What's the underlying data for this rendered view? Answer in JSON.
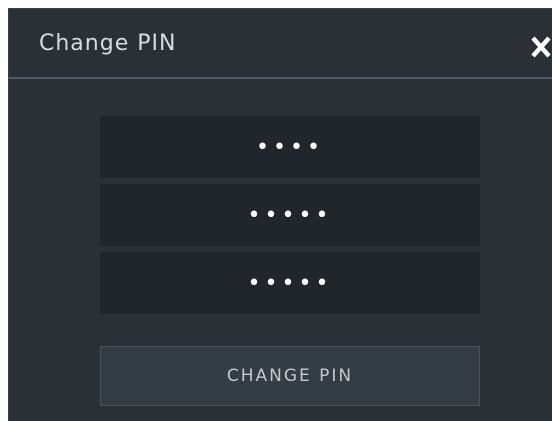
{
  "dialog": {
    "title": "Change PIN",
    "close_icon": "close-icon"
  },
  "fields": [
    {
      "name": "current-pin",
      "value": "••••"
    },
    {
      "name": "new-pin",
      "value": "•••••"
    },
    {
      "name": "confirm-pin",
      "value": "•••••"
    }
  ],
  "submit": {
    "label": "CHANGE PIN"
  },
  "colors": {
    "dialog_bg": "#2a3036",
    "field_bg": "#20262b",
    "button_bg": "#353d44",
    "divider": "#4e5a63",
    "title_text": "#d6dbdf",
    "button_text": "#c3c8cd",
    "close_icon": "#ffffff"
  }
}
